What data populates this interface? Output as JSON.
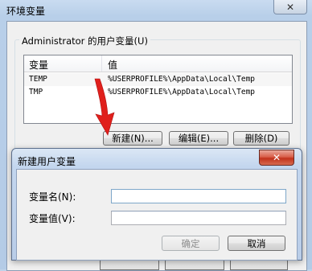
{
  "outer_window": {
    "title": "环境变量",
    "close_glyph": "✕"
  },
  "user_vars": {
    "group_label": "Administrator 的用户变量(U)",
    "columns": [
      "变量",
      "值"
    ],
    "rows": [
      {
        "name": "TEMP",
        "value": "%USERPROFILE%\\AppData\\Local\\Temp"
      },
      {
        "name": "TMP",
        "value": "%USERPROFILE%\\AppData\\Local\\Temp"
      }
    ],
    "buttons": {
      "new": "新建(N)...",
      "edit": "编辑(E)...",
      "delete": "删除(D)"
    }
  },
  "new_dialog": {
    "title": "新建用户变量",
    "close_glyph": "✕",
    "name_label": "变量名(N):",
    "name_value": "",
    "value_label": "变量值(V):",
    "value_value": "",
    "ok_label": "确定",
    "cancel_label": "取消"
  },
  "annotation": {
    "arrow_color": "#e0201c"
  }
}
